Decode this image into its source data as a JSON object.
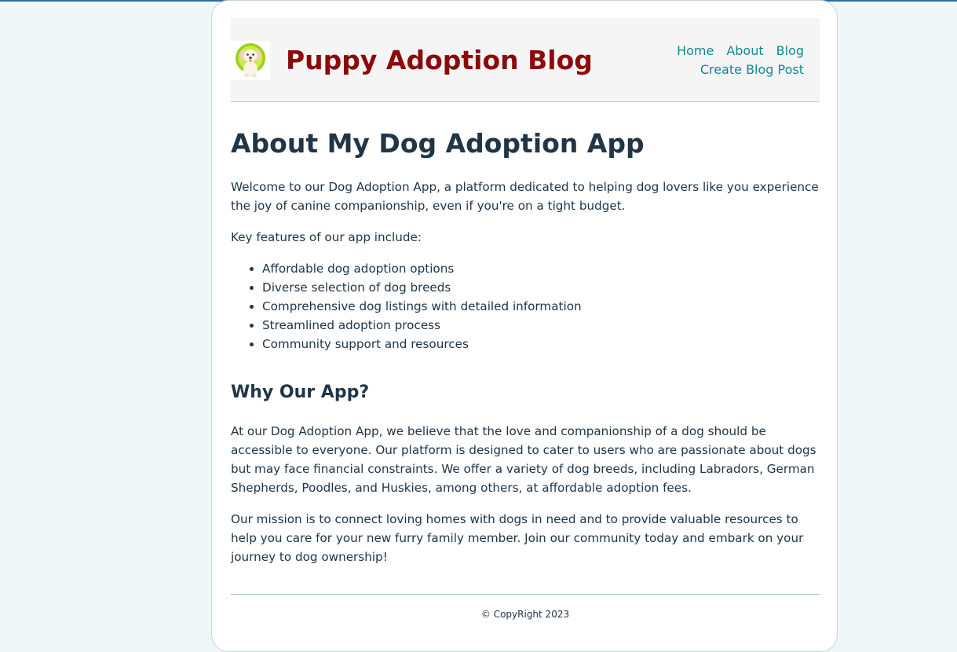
{
  "header": {
    "site_title": "Puppy Adoption Blog",
    "logo_alt": "puppy-logo",
    "nav": {
      "home": "Home",
      "about": "About",
      "blog": "Blog",
      "create_post": "Create Blog Post"
    }
  },
  "main": {
    "heading": "About My Dog Adoption App",
    "intro": "Welcome to our Dog Adoption App, a platform dedicated to helping dog lovers like you experience the joy of canine companionship, even if you're on a tight budget.",
    "features_intro": "Key features of our app include:",
    "features": [
      "Affordable dog adoption options",
      "Diverse selection of dog breeds",
      "Comprehensive dog listings with detailed information",
      "Streamlined adoption process",
      "Community support and resources"
    ],
    "why_heading": "Why Our App?",
    "why_paragraph": "At our Dog Adoption App, we believe that the love and companionship of a dog should be accessible to everyone. Our platform is designed to cater to users who are passionate about dogs but may face financial constraints. We offer a variety of dog breeds, including Labradors, German Shepherds, Poodles, and Huskies, among others, at affordable adoption fees.",
    "mission_paragraph": "Our mission is to connect loving homes with dogs in need and to provide valuable resources to help you care for your new furry family member. Join our community today and embark on your journey to dog ownership!"
  },
  "footer": {
    "copyright": "© CopyRight 2023"
  },
  "colors": {
    "title": "#8b0a0a",
    "nav_link": "#0e8a8e",
    "text": "#213547",
    "page_bg": "#f0f7f8"
  }
}
